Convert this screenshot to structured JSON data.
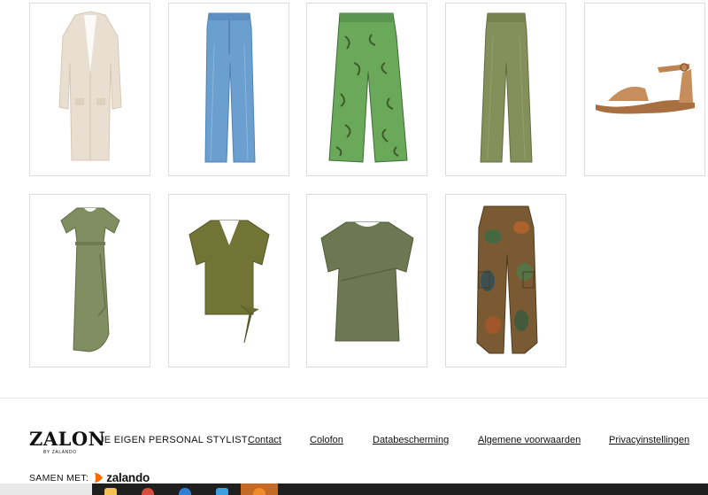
{
  "products": [
    {
      "name": "cardigan",
      "color": "#e7dccd"
    },
    {
      "name": "wide-leg-jeans",
      "color": "#5b95c8"
    },
    {
      "name": "printed-trousers",
      "color": "#5e9a4e"
    },
    {
      "name": "olive-trousers",
      "color": "#7f8a55"
    },
    {
      "name": "sandal",
      "color": "#c08a5a"
    },
    {
      "name": "maxi-dress",
      "color": "#7d8a60"
    },
    {
      "name": "knot-tshirt",
      "color": "#6f7035"
    },
    {
      "name": "peplum-tshirt",
      "color": "#6b7550"
    },
    {
      "name": "camo-cargo-trousers",
      "color": "#7a5a33"
    }
  ],
  "footer": {
    "logo": "ZALON",
    "logo_sub": "BY ZALANDO",
    "tagline": "JE EIGEN PERSONAL STYLIST",
    "links": [
      "Contact",
      "Colofon",
      "Databescherming",
      "Algemene voorwaarden",
      "Privacyinstellingen"
    ],
    "partner_label": "SAMEN MET:",
    "partner_brand": "zalando",
    "partner_color": "#ff6900"
  },
  "taskbar": {
    "icons": [
      "file-explorer-icon",
      "chrome-icon",
      "edge-icon",
      "store-icon",
      "firefox-icon"
    ]
  }
}
